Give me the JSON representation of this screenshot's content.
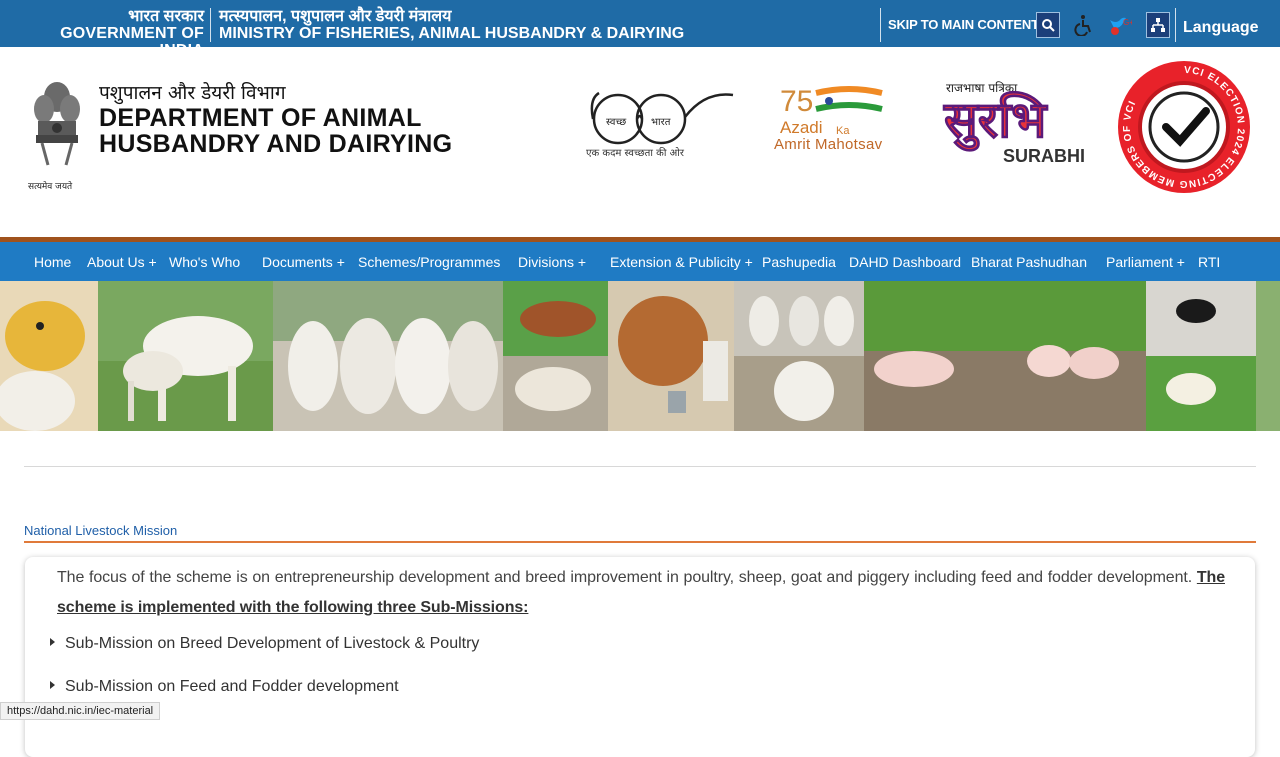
{
  "topbar": {
    "gov_hi": "भारत सरकार",
    "gov_en": "GOVERNMENT OF INDIA",
    "ministry_hi": "मत्स्यपालन, पशुपालन और डेयरी मंत्रालय",
    "ministry_en": "MINISTRY OF FISHERIES, ANIMAL HUSBANDRY & DAIRYING",
    "skip_label": "SKIP TO MAIN CONTENT",
    "language_label": "Language",
    "bg_color": "#1f6ba6"
  },
  "header": {
    "emblem_caption": "सत्यमेव जयते",
    "dept_hi": "पशुपालन और डेयरी विभाग",
    "dept_en_line1": "DEPARTMENT OF ANIMAL",
    "dept_en_line2": "HUSBANDRY AND DAIRYING",
    "swachh_left": "स्वच्छ",
    "swachh_right": "भारत",
    "swachh_caption": "एक कदम स्वच्छता की ओर",
    "azadi_line1": "Azadi",
    "azadi_ka": "Ka",
    "azadi_line2": "Amrit Mahotsav",
    "azadi_75": "75",
    "surabhi_top": "राजभाषा पत्रिका",
    "surabhi_big": "सुरभि",
    "surabhi_en": "SURABHI",
    "vote_ring_text": "VCI ELECTION 2024 ELECTING MEMBERS OF VCI"
  },
  "nav": {
    "items": [
      {
        "label": "Home"
      },
      {
        "label": "About Us +"
      },
      {
        "label": "Who's Who"
      },
      {
        "label": "Documents +"
      },
      {
        "label": "Schemes/Programmes"
      },
      {
        "label": "Divisions +"
      },
      {
        "label": "Extension & Publicity +"
      },
      {
        "label": "Pashupedia"
      },
      {
        "label": "DAHD Dashboard"
      },
      {
        "label": "Bharat Pashudhan"
      },
      {
        "label": "Parliament +"
      },
      {
        "label": "RTI"
      }
    ],
    "bg_color": "#1f7bc4",
    "border_color": "#a0521d"
  },
  "content": {
    "breadcrumb": "National Livestock Mission",
    "para_text": "The focus of the scheme is on entrepreneurship development and breed improvement in poultry, sheep, goat and piggery including feed and fodder development. ",
    "para_bold": "The scheme is implemented with the following three Sub-Missions:",
    "list": [
      {
        "label": "Sub-Mission on Breed Development of Livestock & Poultry"
      },
      {
        "label": "Sub-Mission on Feed and Fodder development"
      }
    ]
  },
  "status_bar": {
    "url": "https://dahd.nic.in/iec-material"
  }
}
